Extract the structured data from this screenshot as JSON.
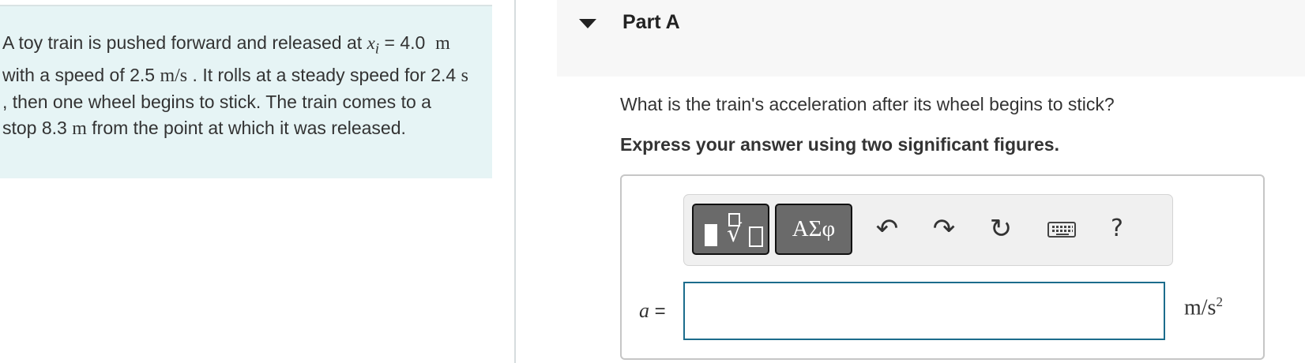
{
  "problem": {
    "text_1": "A toy train is pushed forward and released at ",
    "var_x": "x",
    "var_sub": "i",
    "eq": " = ",
    "x_value": "4.0",
    "x_unit": "m",
    "text_2": " with a speed of 2.5 ",
    "speed_unit": "m/s",
    "text_3": " . It rolls at a steady speed for 2.4 ",
    "time_unit": "s",
    "text_4": " , then one wheel begins to stick. The train comes to a stop 8.3 ",
    "dist_unit": "m",
    "text_5": " from the point at which it was released."
  },
  "part": {
    "title": "Part A",
    "question": "What is the train's acceleration after its wheel begins to stick?",
    "instruction": "Express your answer using two significant figures."
  },
  "toolbar": {
    "greek_label": "ΑΣφ",
    "undo_glyph": "↶",
    "redo_glyph": "↷",
    "reset_glyph": "↻",
    "help_label": "?"
  },
  "answer": {
    "variable": "a",
    "equals": "=",
    "value": "",
    "unit_base": "m/s",
    "unit_exp": "2"
  },
  "icons": {
    "caret": "caret-down-icon",
    "templates": "templates-icon",
    "greek": "greek-symbols-icon",
    "undo": "undo-icon",
    "redo": "redo-icon",
    "reset": "reset-icon",
    "keyboard": "keyboard-icon",
    "help": "help-icon"
  },
  "colors": {
    "problem_bg": "#e6f4f5",
    "input_border": "#1c6c8c",
    "toolbar_button": "#6a6a6a"
  }
}
